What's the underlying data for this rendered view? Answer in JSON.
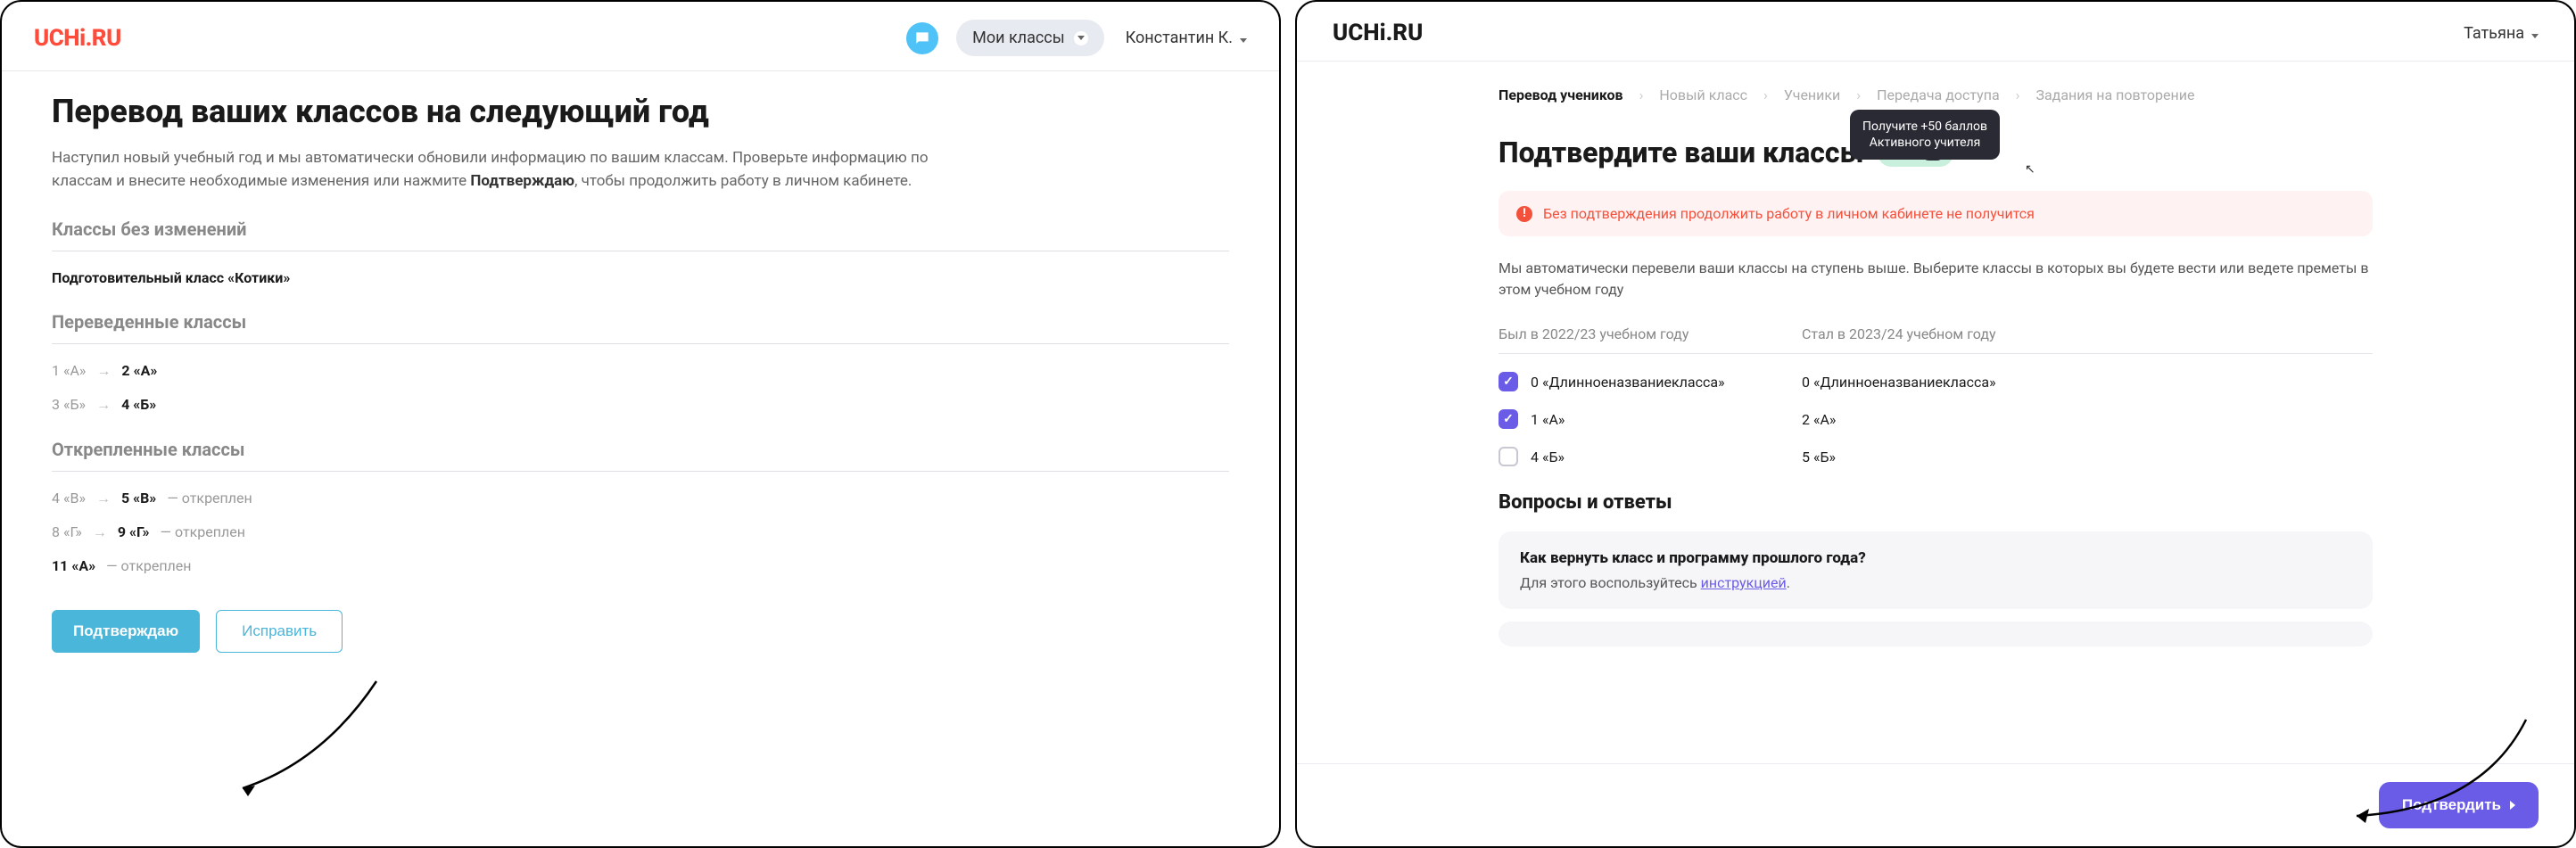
{
  "left": {
    "logo": "UCHi.RU",
    "my_classes": "Мои классы",
    "user": "Константин К.",
    "title": "Перевод ваших классов на следующий год",
    "desc_a": "Наступил новый учебный год и мы автоматически обновили информацию по вашим классам. Проверьте информацию по классам и внесите необходимые изменения или нажмите ",
    "desc_bold": "Подтверждаю",
    "desc_b": ", чтобы продолжить работу в личном кабинете.",
    "section_unchanged": "Классы без изменений",
    "unchanged_1": "Подготовительный класс «Котики»",
    "section_transferred": "Переведенные классы",
    "t1_from": "1 «А»",
    "t1_to": "2 «А»",
    "t2_from": "3 «Б»",
    "t2_to": "4 «Б»",
    "section_detached": "Открепленные классы",
    "d1_from": "4 «В»",
    "d1_to": "5 «В»",
    "d_tag": "— откреплен",
    "d2_from": "8 «Г»",
    "d2_to": "9 «Г»",
    "d3_solo": "11 «А»",
    "btn_confirm": "Подтверждаю",
    "btn_fix": "Исправить"
  },
  "right": {
    "logo": "UCHi.RU",
    "user": "Татьяна",
    "steps": {
      "s1": "Перевод учеников",
      "s2": "Новый класс",
      "s3": "Ученики",
      "s4": "Передача доступа",
      "s5": "Задания на повторение"
    },
    "tooltip_l1": "Получите +50 баллов",
    "tooltip_l2": "Активного учителя",
    "title": "Подтвердите ваши классы",
    "badge_points": "+50",
    "badge_tag": "АУ",
    "alert": "Без подтверждения продолжить работу в личном кабинете не получится",
    "desc": "Мы автоматически перевели ваши классы на ступень выше. Выберите классы в которых вы будете вести или ведете преметы в этом учебном году",
    "col_was": "Был в 2022/23 учебном году",
    "col_now": "Стал в 2023/24 учебном году",
    "rows": {
      "r1_was": "0 «Длинноеназваниекласса»",
      "r1_now": "0 «Длинноеназваниекласса»",
      "r2_was": "1 «А»",
      "r2_now": "2 «А»",
      "r3_was": "4 «Б»",
      "r3_now": "5 «Б»"
    },
    "faq_title": "Вопросы и ответы",
    "faq_q": "Как вернуть класс и программу прошлого года?",
    "faq_a_pre": "Для этого воспользуйтесь ",
    "faq_a_link": "инструкцией",
    "faq_a_post": ".",
    "btn_confirm": "Подтвердить"
  }
}
